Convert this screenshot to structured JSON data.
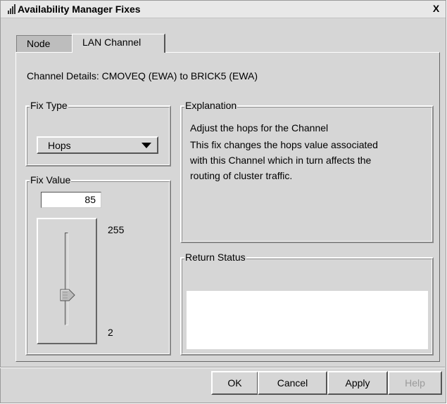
{
  "window": {
    "title": "Availability Manager Fixes",
    "close_label": "X"
  },
  "tabs": [
    {
      "label": "Node"
    },
    {
      "label": "LAN Channel"
    }
  ],
  "channel_details": "Channel Details: CMOVEQ (EWA) to BRICK5 (EWA)",
  "fix_type": {
    "group_label": "Fix Type",
    "selected": "Hops"
  },
  "explanation": {
    "group_label": "Explanation",
    "summary": "Adjust the hops for the Channel",
    "lines": [
      "This fix changes the hops value associated",
      "with this Channel which in turn affects the",
      "routing of cluster traffic."
    ]
  },
  "fix_value": {
    "group_label": "Fix Value",
    "value": "85",
    "max_label": "255",
    "min_label": "2"
  },
  "return_status": {
    "group_label": "Return Status",
    "text": ""
  },
  "buttons": {
    "ok": "OK",
    "cancel": "Cancel",
    "apply": "Apply",
    "help": "Help"
  }
}
